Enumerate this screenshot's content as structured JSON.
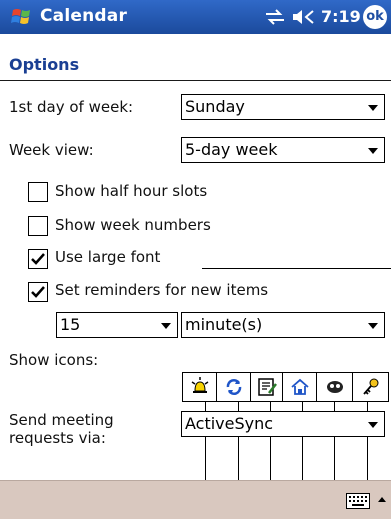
{
  "titlebar": {
    "title": "Calendar",
    "time": "7:19",
    "ok": "ok"
  },
  "header": {
    "title": "Options"
  },
  "settings": {
    "first_day_label": "1st day of week:",
    "first_day_value": "Sunday",
    "week_view_label": "Week view:",
    "week_view_value": "5-day week"
  },
  "checkboxes": [
    {
      "label": "Show half hour slots",
      "checked": false
    },
    {
      "label": "Show week numbers",
      "checked": false
    },
    {
      "label": "Use large font",
      "checked": true
    },
    {
      "label": "Set reminders for new items",
      "checked": true
    }
  ],
  "reminder": {
    "amount": "15",
    "unit": "minute(s)"
  },
  "show_icons": {
    "label": "Show icons:",
    "icons": [
      "alarm-icon",
      "recurrence-icon",
      "note-icon",
      "home-icon",
      "private-icon",
      "key-icon"
    ]
  },
  "meeting": {
    "label_line1": "Send meeting",
    "label_line2": "requests via:",
    "value": "ActiveSync"
  },
  "colors": {
    "titlebar": "#1f4fa3",
    "accent_text": "#1a3f93",
    "bottombar": "#d9c8bf"
  }
}
